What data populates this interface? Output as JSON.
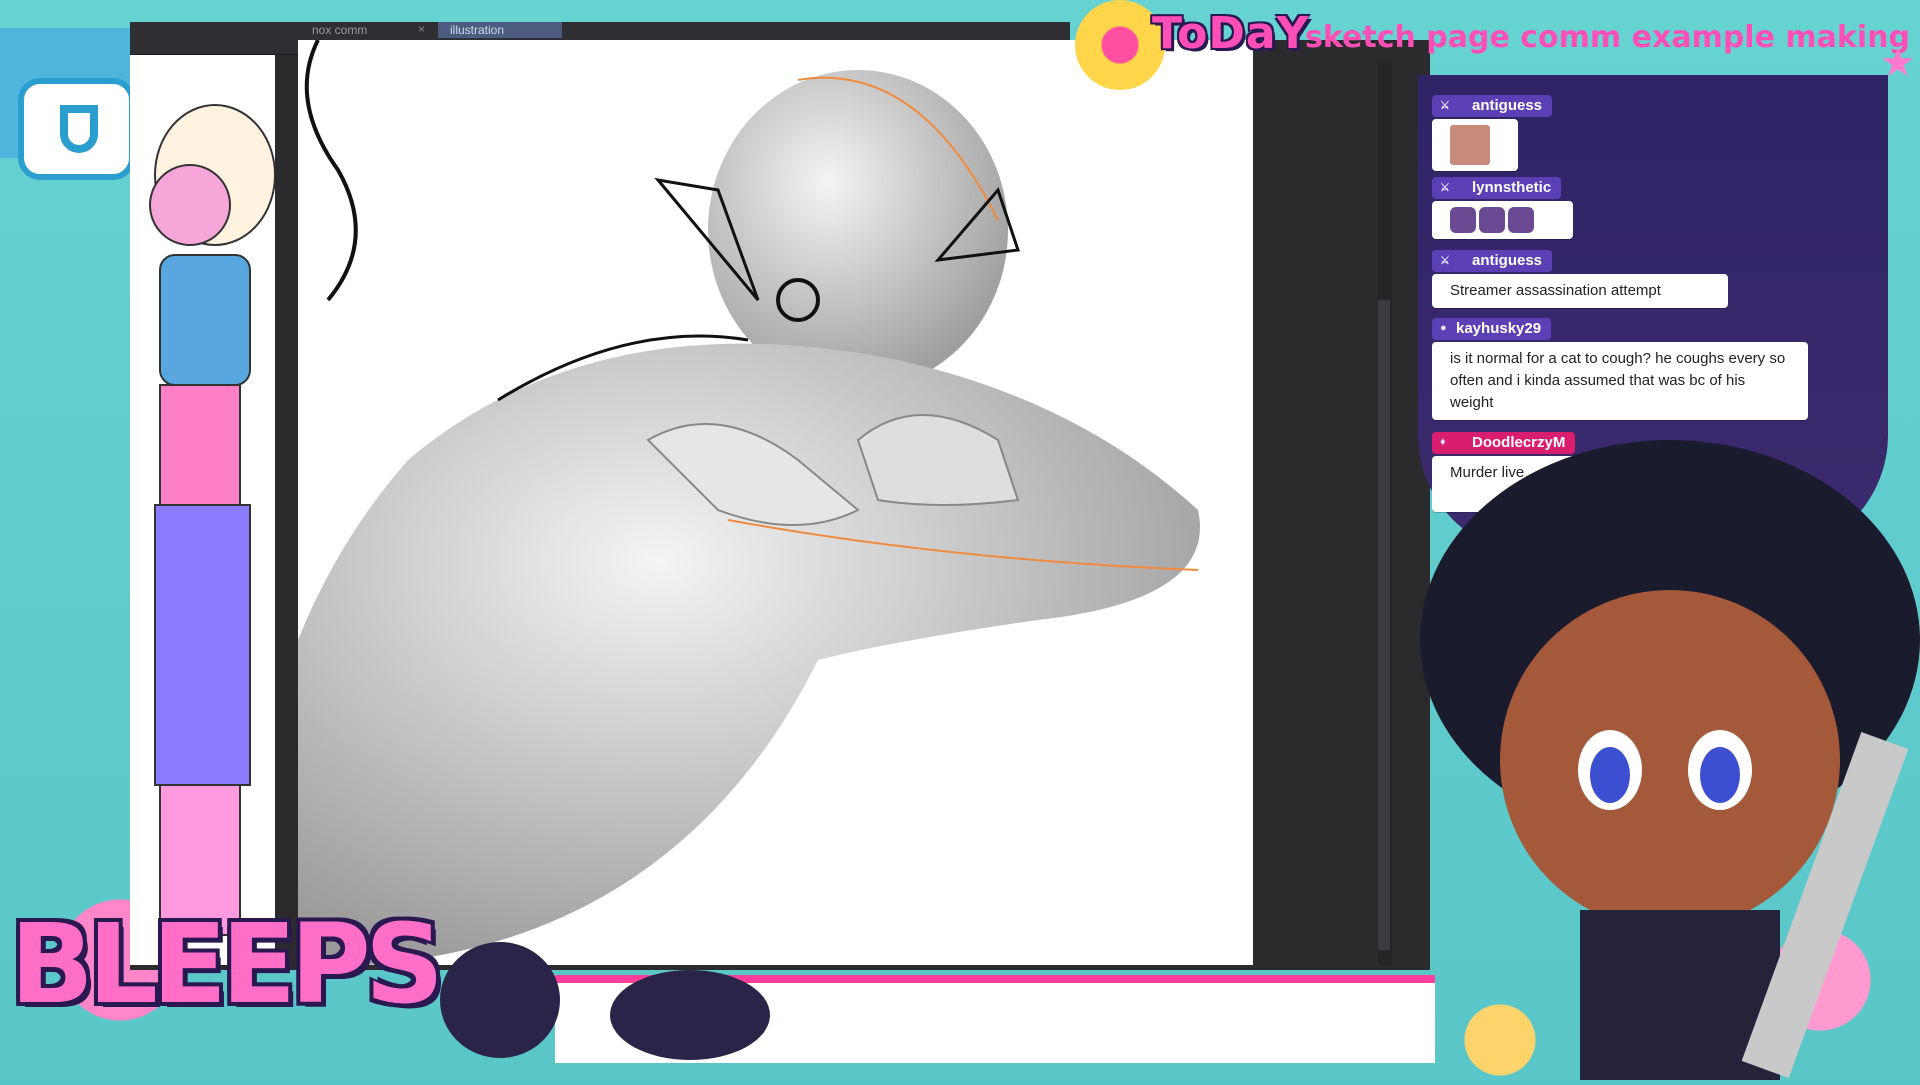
{
  "app": {
    "tabs": [
      {
        "label": "nox comm",
        "active": false
      },
      {
        "label": "illustration",
        "active": true
      }
    ],
    "close_glyph": "×"
  },
  "banner": {
    "today": "ToDaY",
    "title": "sketch page comm example making"
  },
  "logo": {
    "text": "BLEEPS"
  },
  "chat": {
    "messages": [
      {
        "user": "antiguess",
        "badge": "mod",
        "text": "",
        "emotes": [
          "photo-emote"
        ]
      },
      {
        "user": "lynnsthetic",
        "badge": "mod",
        "text": "",
        "emotes": [
          "avatar-emote",
          "avatar-emote",
          "avatar-emote"
        ]
      },
      {
        "user": "antiguess",
        "badge": "mod",
        "text": "Streamer assassination attempt",
        "emotes": []
      },
      {
        "user": "kayhusky29",
        "badge": "viewer",
        "text": "is it normal for a cat to cough? he coughs every so often and i kinda assumed that was bc of his weight",
        "emotes": []
      },
      {
        "user": "DoodlecrzyM",
        "badge": "vip",
        "text": "Murder live",
        "tail": "m",
        "emotes": []
      }
    ]
  },
  "colors": {
    "accent_pink": "#ff3f9a",
    "chat_username_bg": "#5a3fb5",
    "frame_teal": "#56c7c8"
  }
}
